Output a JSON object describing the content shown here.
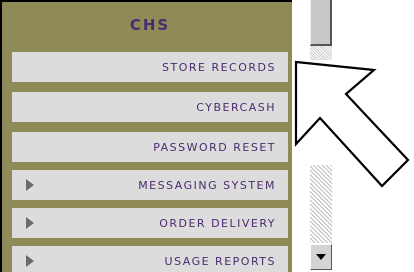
{
  "menu": {
    "title": "CHS",
    "items": [
      {
        "label": "STORE RECORDS",
        "has_arrow": false
      },
      {
        "label": "CYBERCASH",
        "has_arrow": false
      },
      {
        "label": "PASSWORD RESET",
        "has_arrow": false
      },
      {
        "label": "MESSAGING SYSTEM",
        "has_arrow": true
      },
      {
        "label": "ORDER DELIVERY",
        "has_arrow": true
      },
      {
        "label": "USAGE REPORTS",
        "has_arrow": true
      }
    ]
  },
  "colors": {
    "panel": "#8f8b58",
    "item_bg": "#dcdcdc",
    "text": "#4b2b6e"
  },
  "icons": {
    "pointer": "outline-arrow-pointer-icon",
    "submenu": "triangle-right-icon",
    "scroll_down": "scroll-down-icon"
  }
}
